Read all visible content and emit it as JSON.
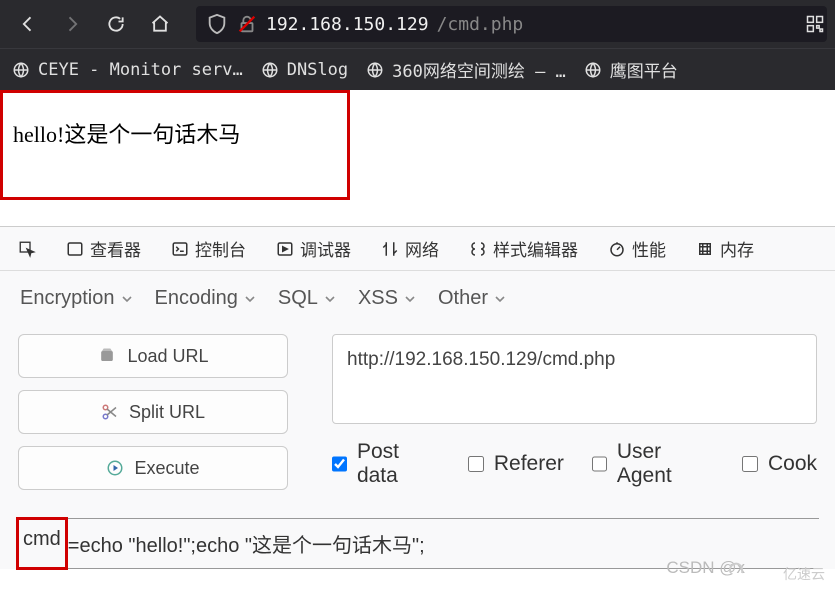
{
  "nav": {
    "address_host": "192.168.150.129",
    "address_path": "/cmd.php"
  },
  "bookmarks": [
    {
      "label": "CEYE - Monitor serv…"
    },
    {
      "label": "DNSlog"
    },
    {
      "label": "360网络空间测绘 — …"
    },
    {
      "label": "鹰图平台"
    }
  ],
  "page": {
    "output": "hello!这是个一句话木马"
  },
  "devtools": {
    "tabs": {
      "inspector": "查看器",
      "console": "控制台",
      "debugger": "调试器",
      "network": "网络",
      "style_editor": "样式编辑器",
      "performance": "性能",
      "memory": "内存"
    },
    "hackbar": {
      "menus": {
        "encryption": "Encryption",
        "encoding": "Encoding",
        "sql": "SQL",
        "xss": "XSS",
        "other": "Other"
      },
      "buttons": {
        "load_url": "Load URL",
        "split_url": "Split URL",
        "execute": "Execute"
      },
      "url_value": "http://192.168.150.129/cmd.php",
      "checks": {
        "post_data": "Post data",
        "referer": "Referer",
        "user_agent": "User Agent",
        "cookies": "Cook"
      },
      "cmd_label": "cmd",
      "cmd_rest": "=echo \"hello!\";echo \"这是个一句话木马\";"
    }
  },
  "watermark": "CSDN @x",
  "cloud_brand": "亿速云"
}
